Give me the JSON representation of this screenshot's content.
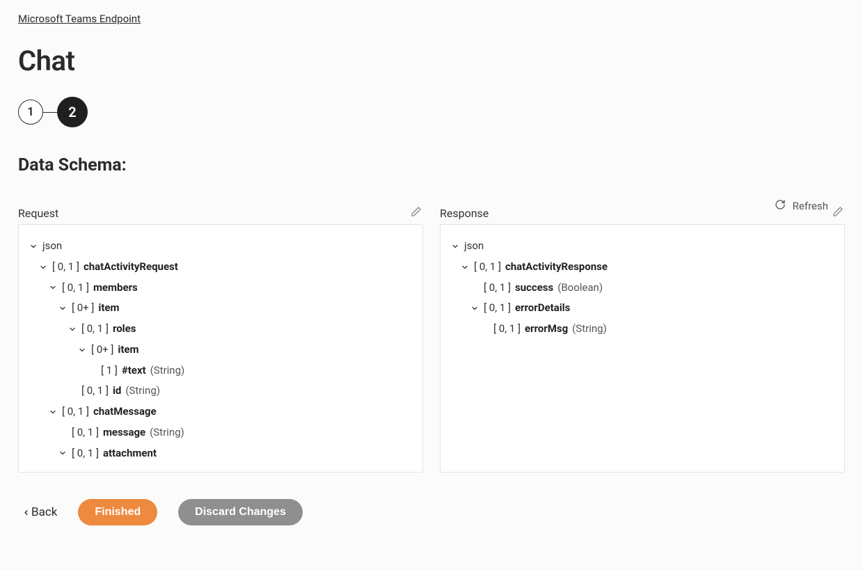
{
  "breadcrumb": "Microsoft Teams Endpoint",
  "title": "Chat",
  "steps": [
    "1",
    "2"
  ],
  "activeStepIndex": 1,
  "sectionTitle": "Data Schema:",
  "refreshLabel": "Refresh",
  "request": {
    "label": "Request",
    "root": "json",
    "nodes": [
      {
        "indent": 1,
        "caret": true,
        "card": "[ 0, 1 ]",
        "name": "chatActivityRequest",
        "type": ""
      },
      {
        "indent": 2,
        "caret": true,
        "card": "[ 0, 1 ]",
        "name": "members",
        "type": ""
      },
      {
        "indent": 3,
        "caret": true,
        "card": "[ 0+ ]",
        "name": "item",
        "type": ""
      },
      {
        "indent": 4,
        "caret": true,
        "card": "[ 0, 1 ]",
        "name": "roles",
        "type": ""
      },
      {
        "indent": 5,
        "caret": true,
        "card": "[ 0+ ]",
        "name": "item",
        "type": ""
      },
      {
        "indent": 6,
        "caret": false,
        "card": "[ 1 ]",
        "name": "#text",
        "type": "(String)"
      },
      {
        "indent": 4,
        "caret": false,
        "card": "[ 0, 1 ]",
        "name": "id",
        "type": "(String)"
      },
      {
        "indent": 2,
        "caret": true,
        "card": "[ 0, 1 ]",
        "name": "chatMessage",
        "type": ""
      },
      {
        "indent": 3,
        "caret": false,
        "card": "[ 0, 1 ]",
        "name": "message",
        "type": "(String)"
      },
      {
        "indent": 3,
        "caret": true,
        "card": "[ 0, 1 ]",
        "name": "attachment",
        "type": ""
      }
    ]
  },
  "response": {
    "label": "Response",
    "root": "json",
    "nodes": [
      {
        "indent": 1,
        "caret": true,
        "card": "[ 0, 1 ]",
        "name": "chatActivityResponse",
        "type": ""
      },
      {
        "indent": 2,
        "caret": false,
        "card": "[ 0, 1 ]",
        "name": "success",
        "type": "(Boolean)"
      },
      {
        "indent": 2,
        "caret": true,
        "card": "[ 0, 1 ]",
        "name": "errorDetails",
        "type": ""
      },
      {
        "indent": 3,
        "caret": false,
        "card": "[ 0, 1 ]",
        "name": "errorMsg",
        "type": "(String)"
      }
    ]
  },
  "footer": {
    "back": "Back",
    "finished": "Finished",
    "discard": "Discard Changes"
  }
}
